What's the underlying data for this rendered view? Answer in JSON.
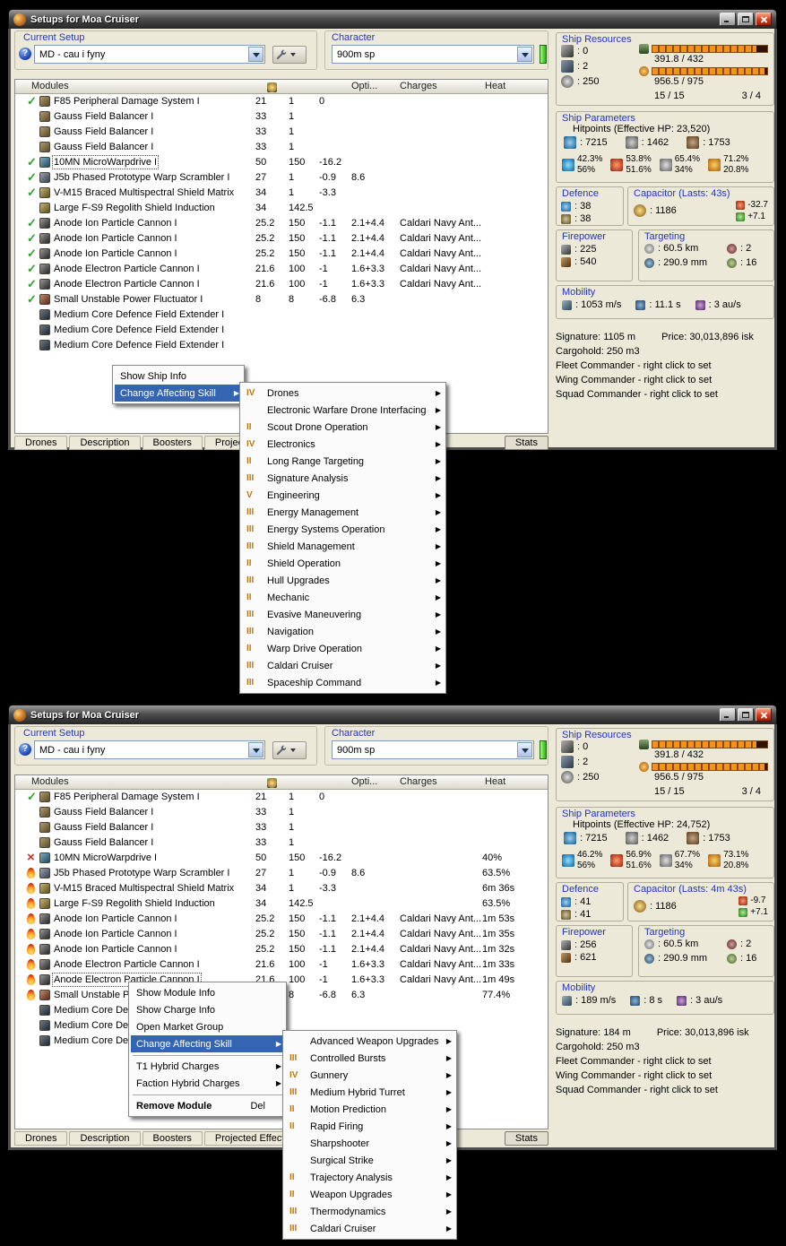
{
  "win1": {
    "title": "Setups for Moa Cruiser",
    "setup": {
      "label": "Current Setup",
      "value": "MD - cau i fyny",
      "help": "?"
    },
    "character": {
      "label": "Character",
      "value": "900m sp"
    },
    "columns": {
      "modules": "Modules",
      "opti": "Opti...",
      "charges": "Charges",
      "heat": "Heat"
    },
    "header_icons": [
      "cpu-icon",
      "powergrid-icon",
      "capacitor-icon"
    ],
    "rows": [
      {
        "status": "st-check",
        "icon": "ic-mod",
        "name": "F85 Peripheral Damage System I",
        "cpu": "21",
        "pg": "1",
        "cap": "0"
      },
      {
        "icon": "ic-mod",
        "name": "Gauss Field Balancer I",
        "cpu": "33",
        "pg": "1"
      },
      {
        "icon": "ic-mod",
        "name": "Gauss Field Balancer I",
        "cpu": "33",
        "pg": "1"
      },
      {
        "icon": "ic-mod",
        "name": "Gauss Field Balancer I",
        "cpu": "33",
        "pg": "1"
      },
      {
        "status": "st-check",
        "icon": "ic-prop",
        "name": "10MN MicroWarpdrive I",
        "cpu": "50",
        "pg": "150",
        "cap": "-16.2",
        "sel": "sel"
      },
      {
        "status": "st-check",
        "icon": "ic-scram",
        "name": "J5b Phased Prototype Warp Scrambler I",
        "cpu": "27",
        "pg": "1",
        "cap": "-0.9",
        "opti": "8.6"
      },
      {
        "status": "st-check",
        "icon": "ic-shield",
        "name": "V-M15 Braced Multispectral Shield Matrix",
        "cpu": "34",
        "pg": "1",
        "cap": "-3.3"
      },
      {
        "icon": "ic-shield",
        "name": "Large F-S9 Regolith Shield Induction",
        "cpu": "34",
        "pg": "142.5"
      },
      {
        "status": "st-check",
        "icon": "ic-gun",
        "name": "Anode Ion Particle Cannon I",
        "cpu": "25.2",
        "pg": "150",
        "cap": "-1.1",
        "opti": "2.1+4.4",
        "charge": "Caldari Navy Ant..."
      },
      {
        "status": "st-check",
        "icon": "ic-gun",
        "name": "Anode Ion Particle Cannon I",
        "cpu": "25.2",
        "pg": "150",
        "cap": "-1.1",
        "opti": "2.1+4.4",
        "charge": "Caldari Navy Ant..."
      },
      {
        "status": "st-check",
        "icon": "ic-gun",
        "name": "Anode Ion Particle Cannon I",
        "cpu": "25.2",
        "pg": "150",
        "cap": "-1.1",
        "opti": "2.1+4.4",
        "charge": "Caldari Navy Ant..."
      },
      {
        "status": "st-check",
        "icon": "ic-gun",
        "name": "Anode Electron Particle Cannon I",
        "cpu": "21.6",
        "pg": "100",
        "cap": "-1",
        "opti": "1.6+3.3",
        "charge": "Caldari Navy Ant..."
      },
      {
        "status": "st-check",
        "icon": "ic-gun",
        "name": "Anode Electron Particle Cannon I",
        "cpu": "21.6",
        "pg": "100",
        "cap": "-1",
        "opti": "1.6+3.3",
        "charge": "Caldari Navy Ant..."
      },
      {
        "status": "st-check",
        "icon": "ic-neut",
        "name": "Small Unstable Power Fluctuator I",
        "cpu": "8",
        "pg": "8",
        "cap": "-6.8",
        "opti": "6.3"
      },
      {
        "icon": "ic-rig",
        "name": "Medium Core Defence Field Extender I"
      },
      {
        "icon": "ic-rig",
        "name": "Medium Core Defence Field Extender I"
      },
      {
        "icon": "ic-rig",
        "name": "Medium Core Defence Field Extender I"
      }
    ],
    "tabs": [
      "Drones",
      "Description",
      "Boosters",
      "Projected Effects",
      "Stats"
    ],
    "menu": {
      "items": [
        {
          "label": "Show Ship Info"
        },
        {
          "label": "Change Affecting Skill",
          "cls": "hl",
          "arrow": "▶"
        }
      ]
    },
    "submenu": {
      "items": [
        {
          "level": "IV",
          "label": "Drones",
          "arrow": "▶"
        },
        {
          "level": "",
          "label": "Electronic Warfare Drone Interfacing",
          "arrow": "▶"
        },
        {
          "level": "II",
          "label": "Scout Drone Operation",
          "arrow": "▶"
        },
        {
          "level": "IV",
          "label": "Electronics",
          "arrow": "▶"
        },
        {
          "level": "II",
          "label": "Long Range Targeting",
          "arrow": "▶"
        },
        {
          "level": "III",
          "label": "Signature Analysis",
          "arrow": "▶"
        },
        {
          "level": "V",
          "label": "Engineering",
          "arrow": "▶"
        },
        {
          "level": "III",
          "label": "Energy Management",
          "arrow": "▶"
        },
        {
          "level": "III",
          "label": "Energy Systems Operation",
          "arrow": "▶"
        },
        {
          "level": "III",
          "label": "Shield Management",
          "arrow": "▶"
        },
        {
          "level": "II",
          "label": "Shield Operation",
          "arrow": "▶"
        },
        {
          "level": "III",
          "label": "Hull Upgrades",
          "arrow": "▶"
        },
        {
          "level": "II",
          "label": "Mechanic",
          "arrow": "▶"
        },
        {
          "level": "III",
          "label": "Evasive Maneuvering",
          "arrow": "▶"
        },
        {
          "level": "III",
          "label": "Navigation",
          "arrow": "▶"
        },
        {
          "level": "II",
          "label": "Warp Drive Operation",
          "arrow": "▶"
        },
        {
          "level": "III",
          "label": "Caldari Cruiser",
          "arrow": "▶"
        },
        {
          "level": "III",
          "label": "Spaceship Command",
          "arrow": "▶"
        }
      ]
    },
    "resources": {
      "header": "Ship Resources",
      "slots": [
        {
          "icon": "turret-icon",
          "value": ": 0"
        },
        {
          "icon": "launcher-icon",
          "value": ": 2"
        },
        {
          "icon": "calibration-icon",
          "value": ": 250"
        }
      ],
      "bars": [
        {
          "icon": "cpu-icon",
          "text": "391.8 / 432",
          "fill": 91
        },
        {
          "icon": "powergrid-icon",
          "text": "956.5 / 975",
          "fill": 98
        }
      ],
      "extra_left": "15 / 15",
      "extra_right": "3 / 4"
    },
    "parameters": {
      "header": "Ship Parameters",
      "hp_label": "Hitpoints (Effective HP: 23,520)",
      "hp": [
        {
          "icon": "shield-icon",
          "value": ": 7215"
        },
        {
          "icon": "armor-icon",
          "value": ": 1462"
        },
        {
          "icon": "structure-icon",
          "value": ": 1753"
        }
      ],
      "resists": [
        {
          "icon": "em-icon",
          "top": "42.3%",
          "bottom": "56%"
        },
        {
          "icon": "thermal-icon",
          "top": "53.8%",
          "bottom": "51.6%"
        },
        {
          "icon": "kinetic-icon",
          "top": "65.4%",
          "bottom": "34%"
        },
        {
          "icon": "explosive-icon",
          "top": "71.2%",
          "bottom": "20.8%"
        }
      ]
    },
    "defence": {
      "header": "Defence",
      "rows": [
        {
          "icon": "shield-recharge-icon",
          "value": ": 38"
        },
        {
          "icon": "armor-repair-icon",
          "value": ": 38"
        }
      ]
    },
    "capacitor": {
      "header": "Capacitor (Lasts: 43s)",
      "main_value": ": 1186",
      "deltas": [
        {
          "icon": "cap-drain-icon",
          "value": "-32.7"
        },
        {
          "icon": "cap-boost-icon",
          "value": "+7.1"
        }
      ]
    },
    "firepower": {
      "header": "Firepower",
      "rows": [
        {
          "icon": "volley-icon",
          "value": ": 225"
        },
        {
          "icon": "dps-icon",
          "value": ": 540"
        }
      ]
    },
    "targeting": {
      "header": "Targeting",
      "cells": [
        {
          "icon": "range-icon",
          "value": ": 60.5 km"
        },
        {
          "icon": "max-targets-icon",
          "value": ": 2"
        },
        {
          "icon": "scan-resolution-icon",
          "value": ": 290.9 mm"
        },
        {
          "icon": "sensor-strength-icon",
          "value": ": 16"
        }
      ]
    },
    "mobility": {
      "header": "Mobility",
      "cells": [
        {
          "icon": "speed-icon",
          "value": ": 1053 m/s"
        },
        {
          "icon": "align-time-icon",
          "value": ": 11.1 s"
        },
        {
          "icon": "warp-speed-icon",
          "value": ": 3 au/s"
        }
      ]
    },
    "info": {
      "signature": "Signature: 1105 m",
      "price": "Price: 30,013,896 isk",
      "cargo": "Cargohold: 250 m3",
      "commanders": [
        "Fleet Commander - right click to set",
        "Wing Commander - right click to set",
        "Squad Commander - right click to set"
      ]
    }
  },
  "win2": {
    "title": "Setups for Moa Cruiser",
    "setup": {
      "label": "Current Setup",
      "value": "MD - cau i fyny",
      "help": "?"
    },
    "character": {
      "label": "Character",
      "value": "900m sp"
    },
    "columns": {
      "modules": "Modules",
      "opti": "Opti...",
      "charges": "Charges",
      "heat": "Heat"
    },
    "header_icons": [
      "cpu-icon",
      "powergrid-icon",
      "capacitor-icon"
    ],
    "rows": [
      {
        "status": "st-check",
        "icon": "ic-mod",
        "name": "F85 Peripheral Damage System I",
        "cpu": "21",
        "pg": "1",
        "cap": "0"
      },
      {
        "icon": "ic-mod",
        "name": "Gauss Field Balancer I",
        "cpu": "33",
        "pg": "1"
      },
      {
        "icon": "ic-mod",
        "name": "Gauss Field Balancer I",
        "cpu": "33",
        "pg": "1"
      },
      {
        "icon": "ic-mod",
        "name": "Gauss Field Balancer I",
        "cpu": "33",
        "pg": "1"
      },
      {
        "status": "st-x",
        "icon": "ic-prop",
        "name": "10MN MicroWarpdrive I",
        "cpu": "50",
        "pg": "150",
        "cap": "-16.2",
        "heat": "40%"
      },
      {
        "status": "st-flame",
        "icon": "ic-scram",
        "name": "J5b Phased Prototype Warp Scrambler I",
        "cpu": "27",
        "pg": "1",
        "cap": "-0.9",
        "opti": "8.6",
        "heat": "63.5%"
      },
      {
        "status": "st-flame",
        "icon": "ic-shield",
        "name": "V-M15 Braced Multispectral Shield Matrix",
        "cpu": "34",
        "pg": "1",
        "cap": "-3.3",
        "heat": "6m 36s"
      },
      {
        "status": "st-flame",
        "icon": "ic-shield",
        "name": "Large F-S9 Regolith Shield Induction",
        "cpu": "34",
        "pg": "142.5",
        "heat": "63.5%"
      },
      {
        "status": "st-flame",
        "icon": "ic-gun",
        "name": "Anode Ion Particle Cannon I",
        "cpu": "25.2",
        "pg": "150",
        "cap": "-1.1",
        "opti": "2.1+4.4",
        "charge": "Caldari Navy Ant...",
        "heat": "1m 53s"
      },
      {
        "status": "st-flame",
        "icon": "ic-gun",
        "name": "Anode Ion Particle Cannon I",
        "cpu": "25.2",
        "pg": "150",
        "cap": "-1.1",
        "opti": "2.1+4.4",
        "charge": "Caldari Navy Ant...",
        "heat": "1m 35s"
      },
      {
        "status": "st-flame",
        "icon": "ic-gun",
        "name": "Anode Ion Particle Cannon I",
        "cpu": "25.2",
        "pg": "150",
        "cap": "-1.1",
        "opti": "2.1+4.4",
        "charge": "Caldari Navy Ant...",
        "heat": "1m 32s"
      },
      {
        "status": "st-flame",
        "icon": "ic-gun",
        "name": "Anode Electron Particle Cannon I",
        "cpu": "21.6",
        "pg": "100",
        "cap": "-1",
        "opti": "1.6+3.3",
        "charge": "Caldari Navy Ant...",
        "heat": "1m 33s"
      },
      {
        "status": "st-flame",
        "icon": "ic-gun",
        "name": "Anode Electron Particle Cannon I",
        "cpu": "21.6",
        "pg": "100",
        "cap": "-1",
        "opti": "1.6+3.3",
        "charge": "Caldari Navy Ant...",
        "heat": "1m 49s",
        "sel": "sel"
      },
      {
        "status": "st-flame",
        "icon": "ic-neut",
        "name": "Small Unstable Power Fluctuator I",
        "cpu": "8",
        "pg": "8",
        "cap": "-6.8",
        "opti": "6.3",
        "heat": "77.4%"
      },
      {
        "icon": "ic-rig",
        "name": "Medium Core Defence Field Extender I"
      },
      {
        "icon": "ic-rig",
        "name": "Medium Core Defence Field Extender I"
      },
      {
        "icon": "ic-rig",
        "name": "Medium Core Defence Field Extender I"
      }
    ],
    "tabs": [
      "Drones",
      "Description",
      "Boosters",
      "Projected Effects",
      "Stats"
    ],
    "menu": {
      "items": [
        {
          "label": "Show Module Info"
        },
        {
          "label": "Show Charge Info"
        },
        {
          "label": "Open Market Group"
        },
        {
          "label": "Change Affecting Skill",
          "cls": "hl",
          "arrow": "▶"
        },
        {
          "cls": "sep"
        },
        {
          "label": "T1 Hybrid Charges",
          "arrow": "▶"
        },
        {
          "label": "Faction Hybrid Charges",
          "arrow": "▶"
        },
        {
          "cls": "sep"
        },
        {
          "label": "Remove Module",
          "cls": "bold",
          "shortcut": "Del"
        }
      ]
    },
    "submenu": {
      "items": [
        {
          "level": "",
          "label": "Advanced Weapon Upgrades",
          "arrow": "▶"
        },
        {
          "level": "III",
          "label": "Controlled Bursts",
          "arrow": "▶"
        },
        {
          "level": "IV",
          "label": "Gunnery",
          "arrow": "▶"
        },
        {
          "level": "III",
          "label": "Medium Hybrid Turret",
          "arrow": "▶"
        },
        {
          "level": "II",
          "label": "Motion Prediction",
          "arrow": "▶"
        },
        {
          "level": "II",
          "label": "Rapid Firing",
          "arrow": "▶"
        },
        {
          "level": "",
          "label": "Sharpshooter",
          "arrow": "▶"
        },
        {
          "level": "",
          "label": "Surgical Strike",
          "arrow": "▶"
        },
        {
          "level": "II",
          "label": "Trajectory Analysis",
          "arrow": "▶"
        },
        {
          "level": "II",
          "label": "Weapon Upgrades",
          "arrow": "▶"
        },
        {
          "level": "III",
          "label": "Thermodynamics",
          "arrow": "▶"
        },
        {
          "level": "III",
          "label": "Caldari Cruiser",
          "arrow": "▶"
        }
      ]
    },
    "resources": {
      "header": "Ship Resources",
      "slots": [
        {
          "icon": "turret-icon",
          "value": ": 0"
        },
        {
          "icon": "launcher-icon",
          "value": ": 2"
        },
        {
          "icon": "calibration-icon",
          "value": ": 250"
        }
      ],
      "bars": [
        {
          "icon": "cpu-icon",
          "text": "391.8 / 432",
          "fill": 91
        },
        {
          "icon": "powergrid-icon",
          "text": "956.5 / 975",
          "fill": 98
        }
      ],
      "extra_left": "15 / 15",
      "extra_right": "3 / 4"
    },
    "parameters": {
      "header": "Ship Parameters",
      "hp_label": "Hitpoints (Effective HP: 24,752)",
      "hp": [
        {
          "icon": "shield-icon",
          "value": ": 7215"
        },
        {
          "icon": "armor-icon",
          "value": ": 1462"
        },
        {
          "icon": "structure-icon",
          "value": ": 1753"
        }
      ],
      "resists": [
        {
          "icon": "em-icon",
          "top": "46.2%",
          "bottom": "56%"
        },
        {
          "icon": "thermal-icon",
          "top": "56.9%",
          "bottom": "51.6%"
        },
        {
          "icon": "kinetic-icon",
          "top": "67.7%",
          "bottom": "34%"
        },
        {
          "icon": "explosive-icon",
          "top": "73.1%",
          "bottom": "20.8%"
        }
      ]
    },
    "defence": {
      "header": "Defence",
      "rows": [
        {
          "icon": "shield-recharge-icon",
          "value": ": 41"
        },
        {
          "icon": "armor-repair-icon",
          "value": ": 41"
        }
      ]
    },
    "capacitor": {
      "header": "Capacitor (Lasts: 4m 43s)",
      "main_value": ": 1186",
      "deltas": [
        {
          "icon": "cap-drain-icon",
          "value": "-9.7"
        },
        {
          "icon": "cap-boost-icon",
          "value": "+7.1"
        }
      ]
    },
    "firepower": {
      "header": "Firepower",
      "rows": [
        {
          "icon": "volley-icon",
          "value": ": 256"
        },
        {
          "icon": "dps-icon",
          "value": ": 621"
        }
      ]
    },
    "targeting": {
      "header": "Targeting",
      "cells": [
        {
          "icon": "range-icon",
          "value": ": 60.5 km"
        },
        {
          "icon": "max-targets-icon",
          "value": ": 2"
        },
        {
          "icon": "scan-resolution-icon",
          "value": ": 290.9 mm"
        },
        {
          "icon": "sensor-strength-icon",
          "value": ": 16"
        }
      ]
    },
    "mobility": {
      "header": "Mobility",
      "cells": [
        {
          "icon": "speed-icon",
          "value": ": 189 m/s"
        },
        {
          "icon": "align-time-icon",
          "value": ": 8 s"
        },
        {
          "icon": "warp-speed-icon",
          "value": ": 3 au/s"
        }
      ]
    },
    "info": {
      "signature": "Signature: 184 m",
      "price": "Price: 30,013,896 isk",
      "cargo": "Cargohold: 250 m3",
      "commanders": [
        "Fleet Commander - right click to set",
        "Wing Commander - right click to set",
        "Squad Commander - right click to set"
      ]
    }
  }
}
